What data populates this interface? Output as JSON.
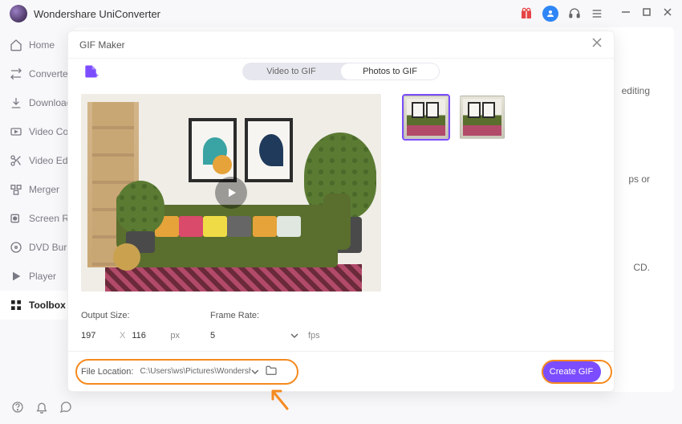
{
  "app": {
    "title": "Wondershare UniConverter"
  },
  "sidebar": {
    "items": [
      {
        "label": "Home"
      },
      {
        "label": "Converter"
      },
      {
        "label": "Downloader"
      },
      {
        "label": "Video Compressor"
      },
      {
        "label": "Video Editor"
      },
      {
        "label": "Merger"
      },
      {
        "label": "Screen Recorder"
      },
      {
        "label": "DVD Burner"
      },
      {
        "label": "Player"
      },
      {
        "label": "Toolbox"
      }
    ]
  },
  "background_hints": {
    "a": "editing",
    "b": "ps or",
    "c": "CD."
  },
  "modal": {
    "title": "GIF Maker",
    "tabs": {
      "video": "Video to GIF",
      "photos": "Photos to GIF"
    },
    "output": {
      "label": "Output Size:",
      "w": "197",
      "h": "116",
      "sep": "X",
      "unit": "px"
    },
    "frame_rate": {
      "label": "Frame Rate:",
      "value": "5",
      "unit": "fps"
    },
    "file_location": {
      "label": "File Location:",
      "path": "C:\\Users\\ws\\Pictures\\Wondersh"
    },
    "create": "Create GIF"
  }
}
